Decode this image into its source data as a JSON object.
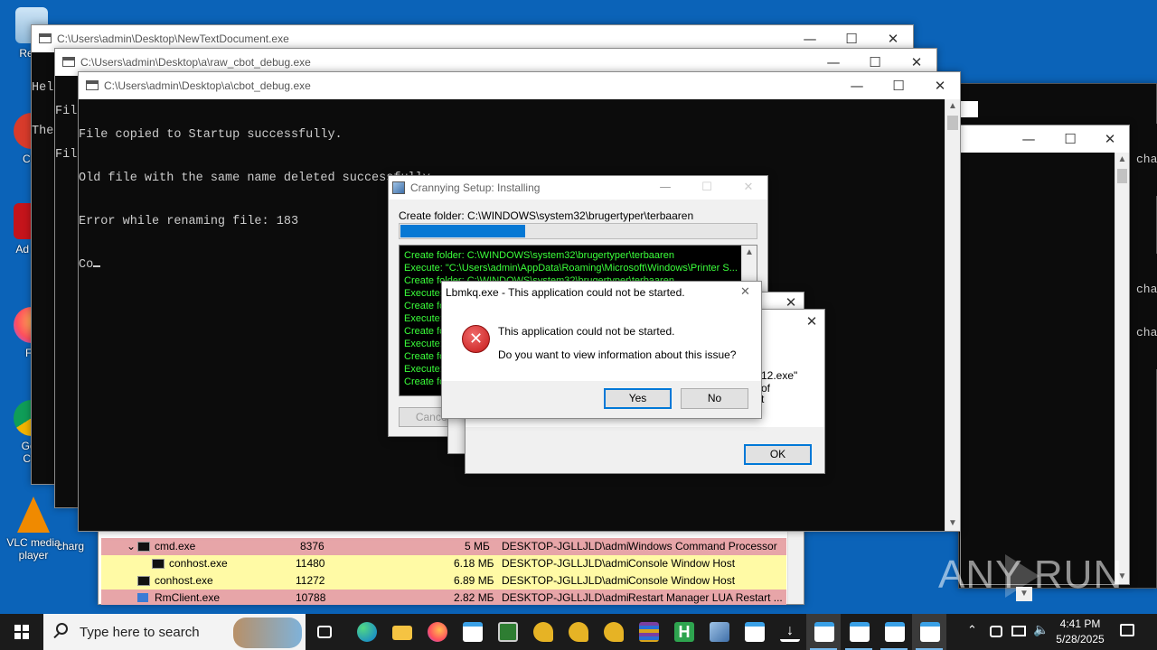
{
  "desktop": {
    "icons": [
      {
        "label": "Recy"
      },
      {
        "label": "CCl"
      },
      {
        "label": "Ad Acr"
      },
      {
        "label": "Fir"
      },
      {
        "label": "Goo Chr"
      },
      {
        "label": "VLC media player"
      },
      {
        "label": "charg"
      }
    ]
  },
  "win_newtext": {
    "title": "C:\\Users\\admin\\Desktop\\NewTextDocument.exe",
    "lines": [
      "Hel",
      "The"
    ]
  },
  "win_raw": {
    "title": "C:\\Users\\admin\\Desktop\\a\\raw_cbot_debug.exe",
    "lines": [
      "Fil",
      "Fil"
    ]
  },
  "win_cbot": {
    "title": "C:\\Users\\admin\\Desktop\\a\\cbot_debug.exe",
    "lines": [
      "File copied to Startup successfully.",
      "Old file with the same name deleted successfully.",
      "Error while renaming file: 183",
      "Co"
    ]
  },
  "right_console": {
    "lines": [
      "cha",
      "cha",
      "cha"
    ]
  },
  "setup": {
    "title": "Crannying Setup: Installing",
    "status": "Create folder: C:\\WINDOWS\\system32\\brugertyper\\terbaaren",
    "progress": 0.35,
    "log": [
      "Create folder: C:\\WINDOWS\\system32\\brugertyper\\terbaaren",
      "Execute: \"C:\\Users\\admin\\AppData\\Roaming\\Microsoft\\Windows\\Printer S...",
      "Create folder: C:\\WINDOWS\\system32\\brugertyper\\terbaaren",
      "Execute:",
      "Create fo",
      "Execute:",
      "Create fo",
      "Execute:",
      "Create fo",
      "Execute:",
      "Create fo"
    ],
    "cancel_label": "Cancel"
  },
  "behind_dialog": {
    "text": [
      "12.exe\"",
      "of",
      "t"
    ],
    "ok_label": "OK"
  },
  "error_dialog": {
    "title": "Lbmkq.exe - This application could not be started.",
    "message": "This application could not be started.",
    "question": "Do you want to view information about this issue?",
    "yes_label": "Yes",
    "no_label": "No"
  },
  "task_manager": {
    "rows": [
      {
        "name": "cmd.exe",
        "pid": "8376",
        "mem": "5 МБ",
        "user": "DESKTOP-JGLLJLD\\admi",
        "desc": "Windows Command Processor"
      },
      {
        "name": "conhost.exe",
        "pid": "11480",
        "mem": "6.18 МБ",
        "user": "DESKTOP-JGLLJLD\\admi",
        "desc": "Console Window Host"
      },
      {
        "name": "conhost.exe",
        "pid": "11272",
        "mem": "6.89 МБ",
        "user": "DESKTOP-JGLLJLD\\admi",
        "desc": "Console Window Host"
      },
      {
        "name": "RmClient.exe",
        "pid": "10788",
        "mem": "2.82 МБ",
        "user": "DESKTOP-JGLLJLD\\admi",
        "desc": "Restart Manager LUA Restart ..."
      }
    ]
  },
  "watermark": "ANY RUN",
  "taskbar": {
    "search_placeholder": "Type here to search",
    "time": "4:41 PM",
    "date": "5/28/2025",
    "colors": {
      "bar": "#1b1b1b",
      "accent": "#76b9ed"
    }
  }
}
